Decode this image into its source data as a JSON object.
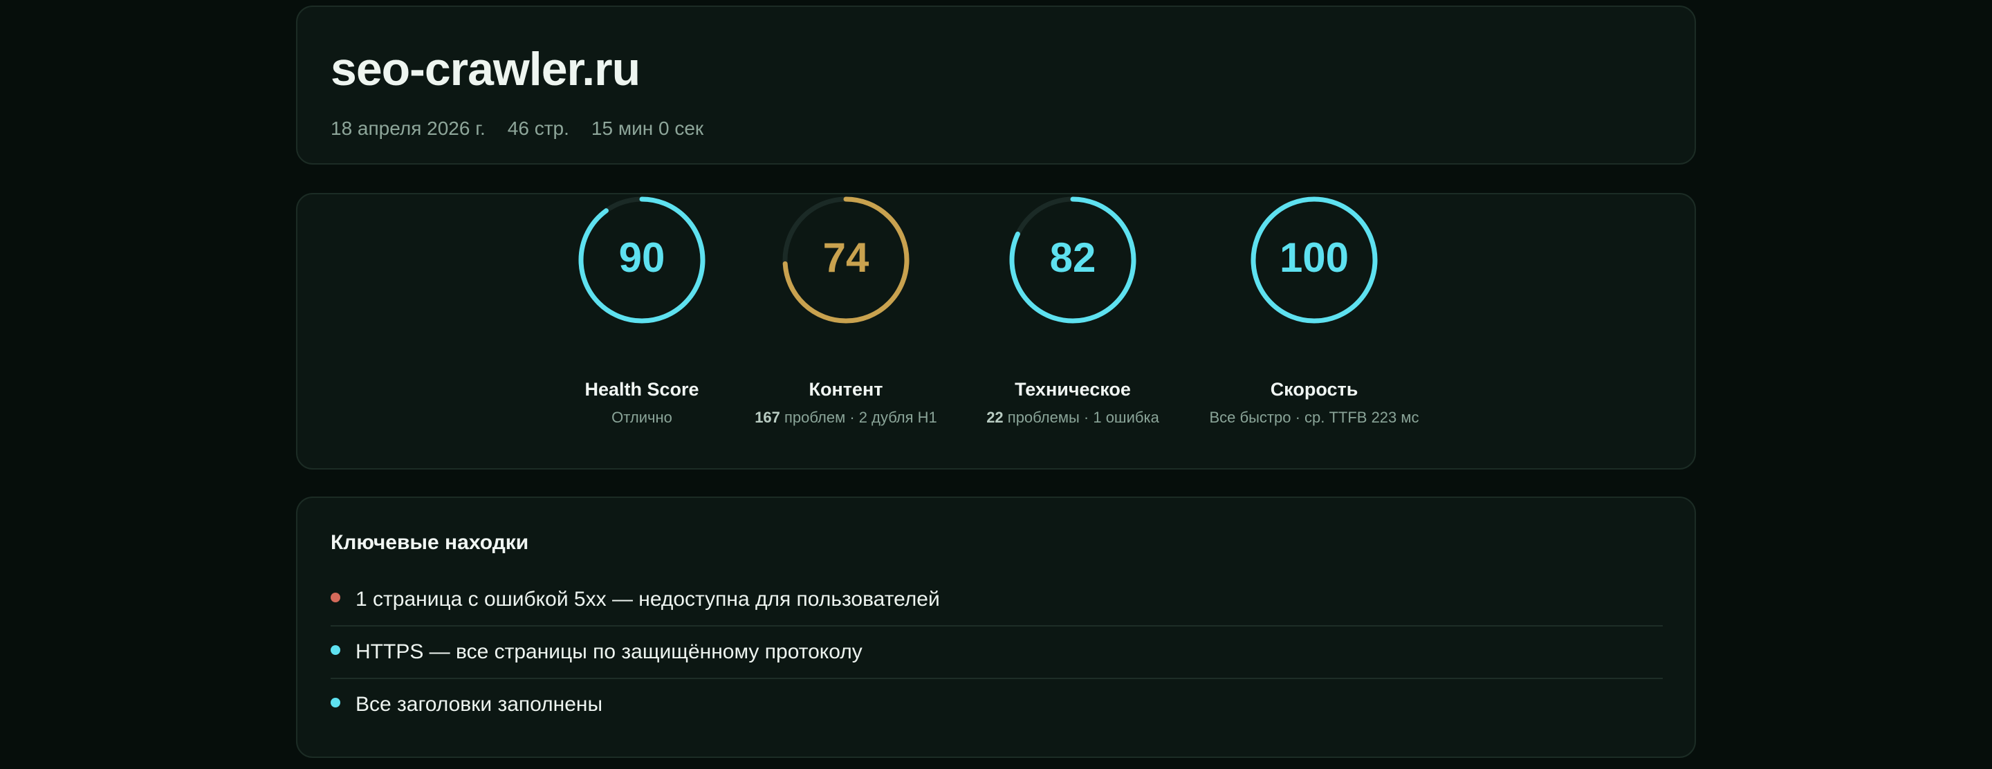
{
  "report": {
    "site": "seo-crawler.ru",
    "date": "18 апреля 2026 г.",
    "pages": "46 стр.",
    "duration": "15 мин 0 сек"
  },
  "colors": {
    "accent": "#5ee1f0",
    "warning": "#c9a24f",
    "error": "#d46a5a",
    "track": "#1b2a26"
  },
  "scores": [
    {
      "value": "90",
      "percent": 90,
      "label": "Health Score",
      "sub_strong": "",
      "sub": "Отлично",
      "color": "#5ee1f0"
    },
    {
      "value": "74",
      "percent": 74,
      "label": "Контент",
      "sub_strong": "167",
      "sub": " проблем · 2 дубля H1",
      "color": "#c9a24f"
    },
    {
      "value": "82",
      "percent": 82,
      "label": "Техническое",
      "sub_strong": "22",
      "sub": " проблемы · 1 ошибка",
      "color": "#5ee1f0"
    },
    {
      "value": "100",
      "percent": 100,
      "label": "Скорость",
      "sub_strong": "",
      "sub": "Все быстро · ср. TTFB 223 мс",
      "color": "#5ee1f0"
    }
  ],
  "findings": {
    "title": "Ключевые находки",
    "items": [
      {
        "text": "1 страница с ошибкой 5xx — недоступна для пользователей",
        "status": "error",
        "dot_color": "#d46a5a"
      },
      {
        "text": "HTTPS — все страницы по защищённому протоколу",
        "status": "ok",
        "dot_color": "#5ee1f0"
      },
      {
        "text": "Все заголовки заполнены",
        "status": "ok",
        "dot_color": "#5ee1f0"
      }
    ]
  }
}
